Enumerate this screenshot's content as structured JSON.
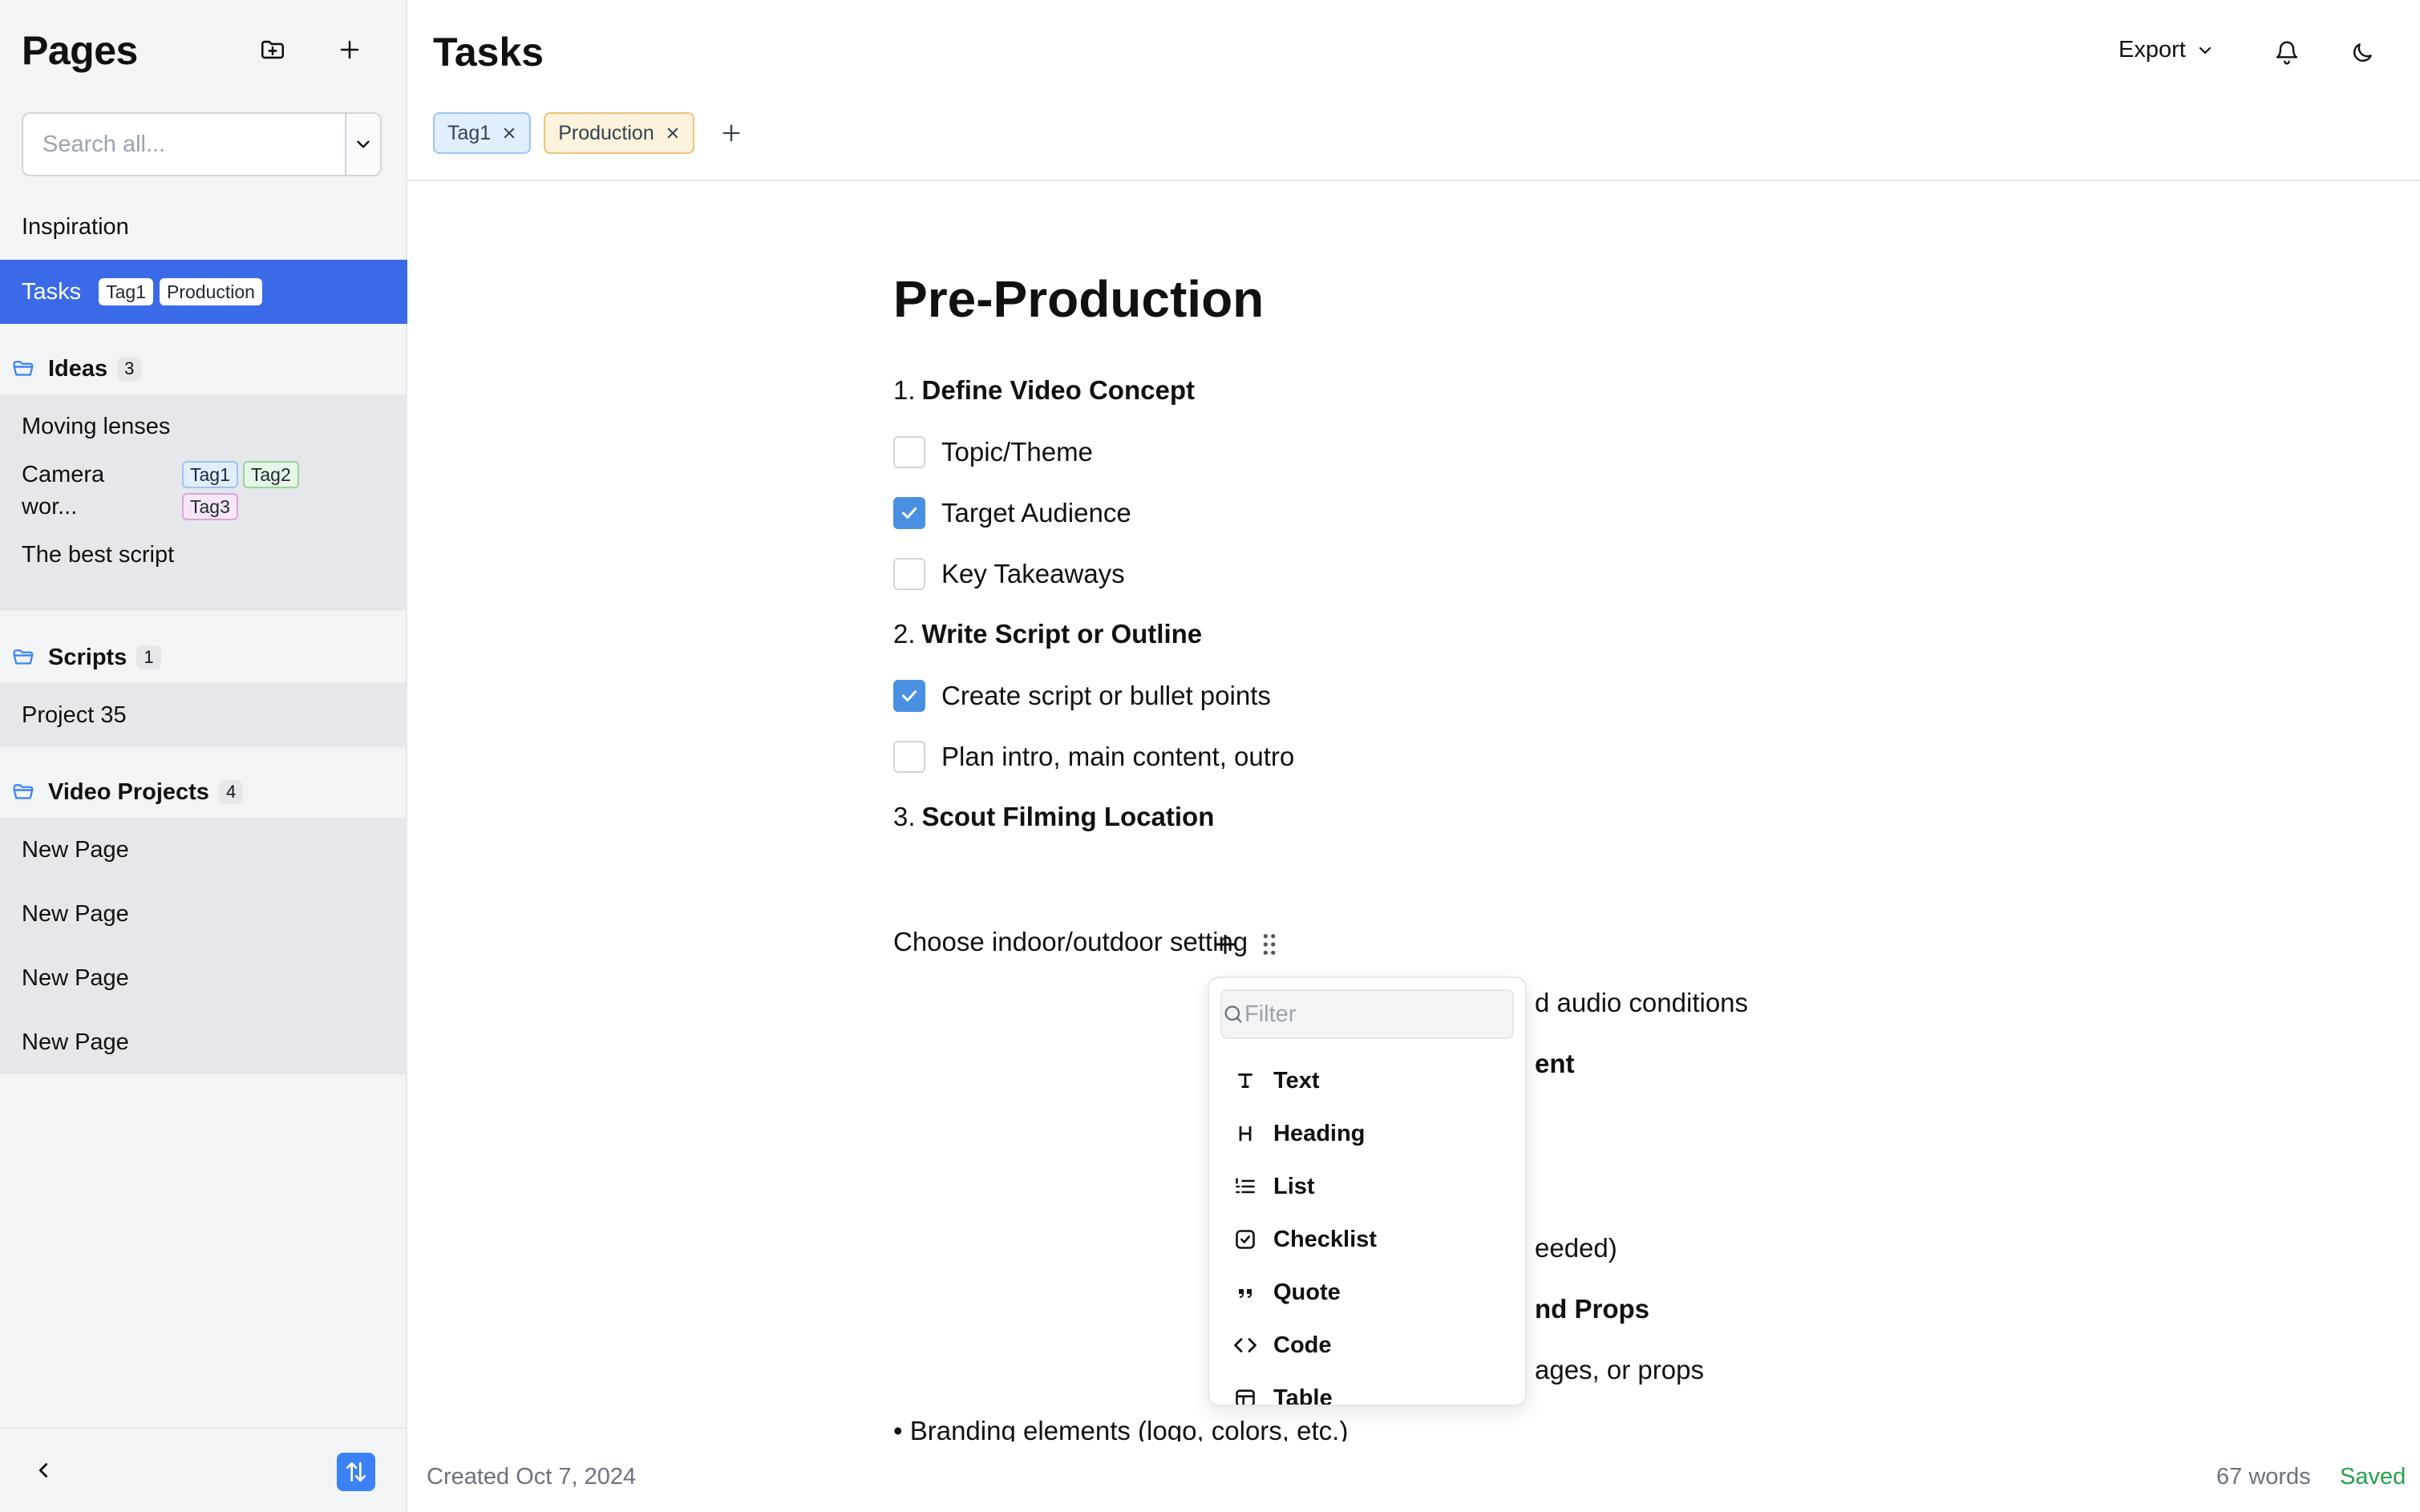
{
  "sidebar": {
    "title": "Pages",
    "search": {
      "placeholder": "Search all...",
      "value": ""
    },
    "pages": [
      {
        "label": "Inspiration"
      },
      {
        "label": "Tasks",
        "tags": [
          "Tag1",
          "Production"
        ]
      }
    ],
    "folders": [
      {
        "name": "Ideas",
        "count": "3",
        "items": [
          {
            "label": "Moving lenses"
          },
          {
            "label_line1": "Camera",
            "label_line2": "wor...",
            "tags": [
              "Tag1",
              "Tag2",
              "Tag3"
            ]
          },
          {
            "label": "The best script"
          }
        ]
      },
      {
        "name": "Scripts",
        "count": "1",
        "items": [
          {
            "label": "Project 35"
          }
        ]
      },
      {
        "name": "Video Projects",
        "count": "4",
        "items": [
          {
            "label": "New Page"
          },
          {
            "label": "New Page"
          },
          {
            "label": "New Page"
          },
          {
            "label": "New Page"
          }
        ]
      }
    ]
  },
  "header": {
    "title": "Tasks",
    "export_label": "Export",
    "tags": [
      "Tag1",
      "Production"
    ]
  },
  "document": {
    "heading": "Pre-Production",
    "lines": [
      {
        "num": "1.",
        "text": "Define Video Concept"
      },
      {
        "text": "Topic/Theme",
        "checked": false
      },
      {
        "text": "Target Audience",
        "checked": true
      },
      {
        "text": "Key Takeaways",
        "checked": false
      },
      {
        "num": "2.",
        "text": "Write Script or Outline"
      },
      {
        "text": "Create script or bullet points",
        "checked": true
      },
      {
        "text": "Plan intro, main content, outro",
        "checked": false
      },
      {
        "num": "3.",
        "text": "Scout Filming Location"
      },
      {
        "text": "Choose indoor/outdoor setting"
      },
      {
        "text": "d audio conditions"
      },
      {
        "text": "ent"
      },
      {
        "text": "eeded)"
      },
      {
        "text": "nd Props"
      },
      {
        "text": "ages, or props"
      },
      {
        "text": "• Branding elements (logo, colors, etc.)"
      }
    ]
  },
  "slash_menu": {
    "filter_placeholder": "Filter",
    "items": [
      {
        "label": "Text",
        "icon": "text-icon"
      },
      {
        "label": "Heading",
        "icon": "heading-icon"
      },
      {
        "label": "List",
        "icon": "list-icon"
      },
      {
        "label": "Checklist",
        "icon": "checklist-icon"
      },
      {
        "label": "Quote",
        "icon": "quote-icon"
      },
      {
        "label": "Code",
        "icon": "code-icon"
      },
      {
        "label": "Table",
        "icon": "table-icon"
      }
    ]
  },
  "footer": {
    "created": "Created Oct 7, 2024",
    "word_count": "67 words",
    "status": "Saved"
  },
  "colors": {
    "accent": "#3b6ae8",
    "checkbox": "#4a90e2",
    "saved": "#22a34a"
  }
}
